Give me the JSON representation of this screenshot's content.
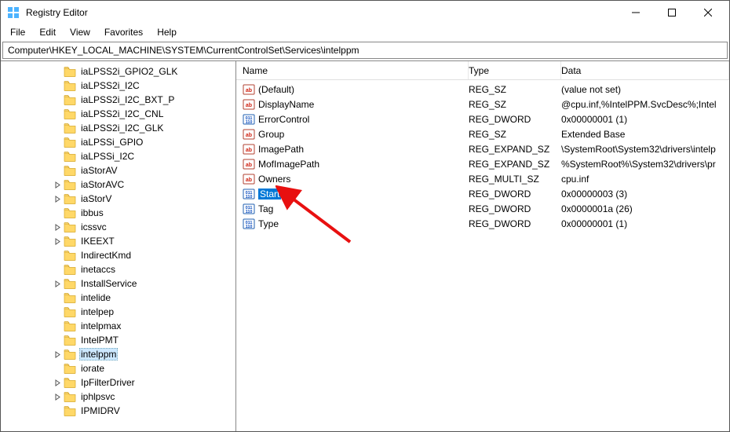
{
  "titlebar": {
    "title": "Registry Editor"
  },
  "menubar": {
    "file": "File",
    "edit": "Edit",
    "view": "View",
    "favorites": "Favorites",
    "help": "Help"
  },
  "addressbar": {
    "path": "Computer\\HKEY_LOCAL_MACHINE\\SYSTEM\\CurrentControlSet\\Services\\intelppm"
  },
  "listHeader": {
    "name": "Name",
    "type": "Type",
    "data": "Data"
  },
  "tree": [
    {
      "label": "iaLPSS2i_GPIO2_GLK",
      "expander": false
    },
    {
      "label": "iaLPSS2i_I2C",
      "expander": false
    },
    {
      "label": "iaLPSS2i_I2C_BXT_P",
      "expander": false
    },
    {
      "label": "iaLPSS2i_I2C_CNL",
      "expander": false
    },
    {
      "label": "iaLPSS2i_I2C_GLK",
      "expander": false
    },
    {
      "label": "iaLPSSi_GPIO",
      "expander": false
    },
    {
      "label": "iaLPSSi_I2C",
      "expander": false
    },
    {
      "label": "iaStorAV",
      "expander": false
    },
    {
      "label": "iaStorAVC",
      "expander": true
    },
    {
      "label": "iaStorV",
      "expander": true
    },
    {
      "label": "ibbus",
      "expander": false
    },
    {
      "label": "icssvc",
      "expander": true
    },
    {
      "label": "IKEEXT",
      "expander": true
    },
    {
      "label": "IndirectKmd",
      "expander": false
    },
    {
      "label": "inetaccs",
      "expander": false
    },
    {
      "label": "InstallService",
      "expander": true
    },
    {
      "label": "intelide",
      "expander": false
    },
    {
      "label": "intelpep",
      "expander": false
    },
    {
      "label": "intelpmax",
      "expander": false
    },
    {
      "label": "IntelPMT",
      "expander": false
    },
    {
      "label": "intelppm",
      "expander": true,
      "selected": true
    },
    {
      "label": "iorate",
      "expander": false
    },
    {
      "label": "IpFilterDriver",
      "expander": true
    },
    {
      "label": "iphlpsvc",
      "expander": true
    },
    {
      "label": "IPMIDRV",
      "expander": false
    }
  ],
  "values": [
    {
      "icon": "sz",
      "name": "(Default)",
      "type": "REG_SZ",
      "data": "(value not set)"
    },
    {
      "icon": "sz",
      "name": "DisplayName",
      "type": "REG_SZ",
      "data": "@cpu.inf,%IntelPPM.SvcDesc%;Intel"
    },
    {
      "icon": "dw",
      "name": "ErrorControl",
      "type": "REG_DWORD",
      "data": "0x00000001 (1)"
    },
    {
      "icon": "sz",
      "name": "Group",
      "type": "REG_SZ",
      "data": "Extended Base"
    },
    {
      "icon": "sz",
      "name": "ImagePath",
      "type": "REG_EXPAND_SZ",
      "data": "\\SystemRoot\\System32\\drivers\\intelp"
    },
    {
      "icon": "sz",
      "name": "MofImagePath",
      "type": "REG_EXPAND_SZ",
      "data": "%SystemRoot%\\System32\\drivers\\pr"
    },
    {
      "icon": "sz",
      "name": "Owners",
      "type": "REG_MULTI_SZ",
      "data": "cpu.inf"
    },
    {
      "icon": "dw",
      "name": "Start",
      "type": "REG_DWORD",
      "data": "0x00000003 (3)",
      "selected": true
    },
    {
      "icon": "dw",
      "name": "Tag",
      "type": "REG_DWORD",
      "data": "0x0000001a (26)"
    },
    {
      "icon": "dw",
      "name": "Type",
      "type": "REG_DWORD",
      "data": "0x00000001 (1)"
    }
  ]
}
